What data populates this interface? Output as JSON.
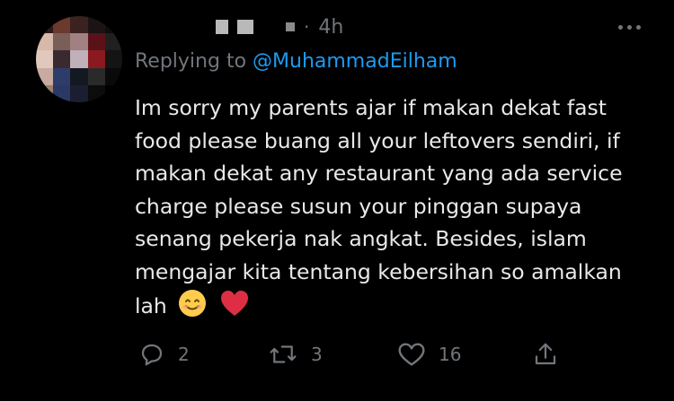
{
  "header": {
    "timestamp": "4h"
  },
  "reply": {
    "prefix": "Replying to ",
    "mention": "@MuhammadEilham"
  },
  "tweet": {
    "text": "Im sorry my parents ajar if makan dekat fast food please buang all your leftovers sendiri, if makan dekat any restaurant yang ada service charge please susun your pinggan supaya senang pekerja nak angkat. Besides, islam mengajar kita tentang kebersihan so amalkan lah",
    "emojis": [
      "smiling-face-emoji",
      "red-heart-emoji"
    ]
  },
  "actions": {
    "reply_count": "2",
    "retweet_count": "3",
    "like_count": "16"
  },
  "colors": {
    "background": "#000000",
    "text": "#e7e9ea",
    "muted": "#71767b",
    "link": "#1d9bf0"
  }
}
